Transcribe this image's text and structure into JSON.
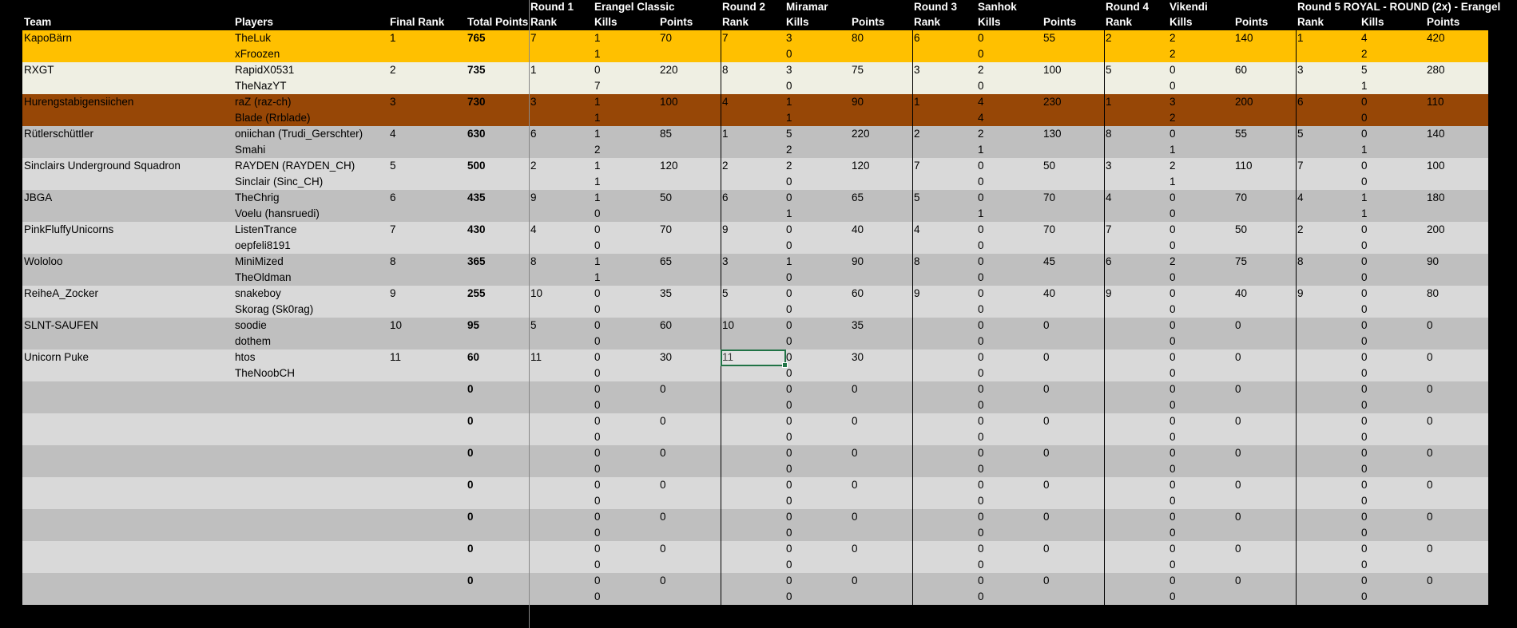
{
  "header": {
    "team": "Team",
    "players": "Players",
    "final_rank": "Final Rank",
    "total_points": "Total Points",
    "rounds": [
      {
        "round": "Round 1",
        "map": "Erangel Classic",
        "rank": "Rank",
        "kills": "Kills",
        "points": "Points"
      },
      {
        "round": "Round 2",
        "map": "Miramar",
        "rank": "Rank",
        "kills": "Kills",
        "points": "Points"
      },
      {
        "round": "Round 3",
        "map": "Sanhok",
        "rank": "Rank",
        "kills": "Kills",
        "points": "Points"
      },
      {
        "round": "Round 4",
        "map": "Vikendi",
        "rank": "Rank",
        "kills": "Kills",
        "points": "Points"
      },
      {
        "round": "Round 5 ROYAL - ROUND (2x) - Erangel",
        "map": "",
        "rank": "Rank",
        "kills": "Kills",
        "points": "Points"
      }
    ]
  },
  "colors": {
    "gold": "#ffc000",
    "cream": "#efefe3",
    "brown": "#974706",
    "grey_dark": "#bfbfbf",
    "grey_light": "#d9d9d9",
    "selection": "#217346"
  },
  "selected_cell": {
    "row": 10,
    "round": 1
  },
  "rows": [
    {
      "team": "KapoBärn",
      "p1": "TheLuk",
      "p2": "xFroozen",
      "final_rank": "1",
      "total": "765",
      "bg": "gold",
      "rounds": [
        {
          "rank": "7",
          "k1": "1",
          "k2": "1",
          "points": "70"
        },
        {
          "rank": "7",
          "k1": "3",
          "k2": "0",
          "points": "80"
        },
        {
          "rank": "6",
          "k1": "0",
          "k2": "0",
          "points": "55"
        },
        {
          "rank": "2",
          "k1": "2",
          "k2": "2",
          "points": "140"
        },
        {
          "rank": "1",
          "k1": "4",
          "k2": "2",
          "points": "420"
        }
      ]
    },
    {
      "team": "RXGT",
      "p1": "RapidX0531",
      "p2": "TheNazYT",
      "final_rank": "2",
      "total": "735",
      "bg": "cream",
      "rounds": [
        {
          "rank": "1",
          "k1": "0",
          "k2": "7",
          "points": "220"
        },
        {
          "rank": "8",
          "k1": "3",
          "k2": "0",
          "points": "75"
        },
        {
          "rank": "3",
          "k1": "2",
          "k2": "0",
          "points": "100"
        },
        {
          "rank": "5",
          "k1": "0",
          "k2": "0",
          "points": "60"
        },
        {
          "rank": "3",
          "k1": "5",
          "k2": "1",
          "points": "280"
        }
      ]
    },
    {
      "team": "Hurengstabigensiichen",
      "p1": "raZ (raz-ch)",
      "p2": "Blade (Rrblade)",
      "final_rank": "3",
      "total": "730",
      "bg": "brown",
      "rounds": [
        {
          "rank": "3",
          "k1": "1",
          "k2": "1",
          "points": "100"
        },
        {
          "rank": "4",
          "k1": "1",
          "k2": "1",
          "points": "90"
        },
        {
          "rank": "1",
          "k1": "4",
          "k2": "4",
          "points": "230"
        },
        {
          "rank": "1",
          "k1": "3",
          "k2": "2",
          "points": "200"
        },
        {
          "rank": "6",
          "k1": "0",
          "k2": "0",
          "points": "110"
        }
      ]
    },
    {
      "team": "Rütlerschüttler",
      "p1": "oniichan (Trudi_Gerschter)",
      "p2": "Smahi",
      "final_rank": "4",
      "total": "630",
      "bg": "grey_dark",
      "rounds": [
        {
          "rank": "6",
          "k1": "1",
          "k2": "2",
          "points": "85"
        },
        {
          "rank": "1",
          "k1": "5",
          "k2": "2",
          "points": "220"
        },
        {
          "rank": "2",
          "k1": "2",
          "k2": "1",
          "points": "130"
        },
        {
          "rank": "8",
          "k1": "0",
          "k2": "1",
          "points": "55"
        },
        {
          "rank": "5",
          "k1": "0",
          "k2": "1",
          "points": "140"
        }
      ]
    },
    {
      "team": "Sinclairs Underground Squadron",
      "p1": "RAYDEN (RAYDEN_CH)",
      "p2": "Sinclair (Sinc_CH)",
      "final_rank": "5",
      "total": "500",
      "bg": "grey_light",
      "rounds": [
        {
          "rank": "2",
          "k1": "1",
          "k2": "1",
          "points": "120"
        },
        {
          "rank": "2",
          "k1": "2",
          "k2": "0",
          "points": "120"
        },
        {
          "rank": "7",
          "k1": "0",
          "k2": "0",
          "points": "50"
        },
        {
          "rank": "3",
          "k1": "2",
          "k2": "1",
          "points": "110"
        },
        {
          "rank": "7",
          "k1": "0",
          "k2": "0",
          "points": "100"
        }
      ]
    },
    {
      "team": "JBGA",
      "p1": "TheChrig",
      "p2": " Voelu (hansruedi)",
      "final_rank": "6",
      "total": "435",
      "bg": "grey_dark",
      "rounds": [
        {
          "rank": "9",
          "k1": "1",
          "k2": "0",
          "points": "50"
        },
        {
          "rank": "6",
          "k1": "0",
          "k2": "1",
          "points": "65"
        },
        {
          "rank": "5",
          "k1": "0",
          "k2": "1",
          "points": "70"
        },
        {
          "rank": "4",
          "k1": "0",
          "k2": "0",
          "points": "70"
        },
        {
          "rank": "4",
          "k1": "1",
          "k2": "1",
          "points": "180"
        }
      ]
    },
    {
      "team": "PinkFluffyUnicorns",
      "p1": "ListenTrance",
      "p2": "oepfeli8191",
      "final_rank": "7",
      "total": "430",
      "bg": "grey_light",
      "rounds": [
        {
          "rank": "4",
          "k1": "0",
          "k2": "0",
          "points": "70"
        },
        {
          "rank": "9",
          "k1": "0",
          "k2": "0",
          "points": "40"
        },
        {
          "rank": "4",
          "k1": "0",
          "k2": "0",
          "points": "70"
        },
        {
          "rank": "7",
          "k1": "0",
          "k2": "0",
          "points": "50"
        },
        {
          "rank": "2",
          "k1": "0",
          "k2": "0",
          "points": "200"
        }
      ]
    },
    {
      "team": "Wololoo",
      "p1": "MiniMized",
      "p2": "TheOldman",
      "final_rank": "8",
      "total": "365",
      "bg": "grey_dark",
      "rounds": [
        {
          "rank": "8",
          "k1": "1",
          "k2": "1",
          "points": "65"
        },
        {
          "rank": "3",
          "k1": "1",
          "k2": "0",
          "points": "90"
        },
        {
          "rank": "8",
          "k1": "0",
          "k2": "0",
          "points": "45"
        },
        {
          "rank": "6",
          "k1": "2",
          "k2": "0",
          "points": "75"
        },
        {
          "rank": "8",
          "k1": "0",
          "k2": "0",
          "points": "90"
        }
      ]
    },
    {
      "team": "ReiheA_Zocker",
      "p1": "snakeboy",
      "p2": "Skorag (Sk0rag)",
      "final_rank": "9",
      "total": "255",
      "bg": "grey_light",
      "rounds": [
        {
          "rank": "10",
          "k1": "0",
          "k2": "0",
          "points": "35"
        },
        {
          "rank": "5",
          "k1": "0",
          "k2": "0",
          "points": "60"
        },
        {
          "rank": "9",
          "k1": "0",
          "k2": "0",
          "points": "40"
        },
        {
          "rank": "9",
          "k1": "0",
          "k2": "0",
          "points": "40"
        },
        {
          "rank": "9",
          "k1": "0",
          "k2": "0",
          "points": "80"
        }
      ]
    },
    {
      "team": "SLNT-SAUFEN",
      "p1": "soodie",
      "p2": "dothem",
      "final_rank": "10",
      "total": "95",
      "bg": "grey_dark",
      "rounds": [
        {
          "rank": "5",
          "k1": "0",
          "k2": "0",
          "points": "60"
        },
        {
          "rank": "10",
          "k1": "0",
          "k2": "0",
          "points": "35"
        },
        {
          "rank": "",
          "k1": "0",
          "k2": "0",
          "points": "0"
        },
        {
          "rank": "",
          "k1": "0",
          "k2": "0",
          "points": "0"
        },
        {
          "rank": "",
          "k1": "0",
          "k2": "0",
          "points": "0"
        }
      ]
    },
    {
      "team": "Unicorn Puke",
      "p1": "htos",
      "p2": "TheNoobCH",
      "final_rank": "11",
      "total": "60",
      "bg": "grey_light",
      "rounds": [
        {
          "rank": "11",
          "k1": "0",
          "k2": "0",
          "points": "30"
        },
        {
          "rank": "11",
          "k1": "0",
          "k2": "0",
          "points": "30"
        },
        {
          "rank": "",
          "k1": "0",
          "k2": "0",
          "points": "0"
        },
        {
          "rank": "",
          "k1": "0",
          "k2": "0",
          "points": "0"
        },
        {
          "rank": "",
          "k1": "0",
          "k2": "0",
          "points": "0"
        }
      ]
    },
    {
      "team": "",
      "p1": "",
      "p2": "",
      "final_rank": "",
      "total": "0",
      "bg": "grey_dark",
      "rounds": [
        {
          "rank": "",
          "k1": "0",
          "k2": "0",
          "points": "0"
        },
        {
          "rank": "",
          "k1": "0",
          "k2": "0",
          "points": "0"
        },
        {
          "rank": "",
          "k1": "0",
          "k2": "0",
          "points": "0"
        },
        {
          "rank": "",
          "k1": "0",
          "k2": "0",
          "points": "0"
        },
        {
          "rank": "",
          "k1": "0",
          "k2": "0",
          "points": "0"
        }
      ]
    },
    {
      "team": "",
      "p1": "",
      "p2": "",
      "final_rank": "",
      "total": "0",
      "bg": "grey_light",
      "rounds": [
        {
          "rank": "",
          "k1": "0",
          "k2": "0",
          "points": "0"
        },
        {
          "rank": "",
          "k1": "0",
          "k2": "0",
          "points": "0"
        },
        {
          "rank": "",
          "k1": "0",
          "k2": "0",
          "points": "0"
        },
        {
          "rank": "",
          "k1": "0",
          "k2": "0",
          "points": "0"
        },
        {
          "rank": "",
          "k1": "0",
          "k2": "0",
          "points": "0"
        }
      ]
    },
    {
      "team": "",
      "p1": "",
      "p2": "",
      "final_rank": "",
      "total": "0",
      "bg": "grey_dark",
      "rounds": [
        {
          "rank": "",
          "k1": "0",
          "k2": "0",
          "points": "0"
        },
        {
          "rank": "",
          "k1": "0",
          "k2": "0",
          "points": "0"
        },
        {
          "rank": "",
          "k1": "0",
          "k2": "0",
          "points": "0"
        },
        {
          "rank": "",
          "k1": "0",
          "k2": "0",
          "points": "0"
        },
        {
          "rank": "",
          "k1": "0",
          "k2": "0",
          "points": "0"
        }
      ]
    },
    {
      "team": "",
      "p1": "",
      "p2": "",
      "final_rank": "",
      "total": "0",
      "bg": "grey_light",
      "rounds": [
        {
          "rank": "",
          "k1": "0",
          "k2": "0",
          "points": "0"
        },
        {
          "rank": "",
          "k1": "0",
          "k2": "0",
          "points": "0"
        },
        {
          "rank": "",
          "k1": "0",
          "k2": "0",
          "points": "0"
        },
        {
          "rank": "",
          "k1": "0",
          "k2": "0",
          "points": "0"
        },
        {
          "rank": "",
          "k1": "0",
          "k2": "0",
          "points": "0"
        }
      ]
    },
    {
      "team": "",
      "p1": "",
      "p2": "",
      "final_rank": "",
      "total": "0",
      "bg": "grey_dark",
      "rounds": [
        {
          "rank": "",
          "k1": "0",
          "k2": "0",
          "points": "0"
        },
        {
          "rank": "",
          "k1": "0",
          "k2": "0",
          "points": "0"
        },
        {
          "rank": "",
          "k1": "0",
          "k2": "0",
          "points": "0"
        },
        {
          "rank": "",
          "k1": "0",
          "k2": "0",
          "points": "0"
        },
        {
          "rank": "",
          "k1": "0",
          "k2": "0",
          "points": "0"
        }
      ]
    },
    {
      "team": "",
      "p1": "",
      "p2": "",
      "final_rank": "",
      "total": "0",
      "bg": "grey_light",
      "rounds": [
        {
          "rank": "",
          "k1": "0",
          "k2": "0",
          "points": "0"
        },
        {
          "rank": "",
          "k1": "0",
          "k2": "0",
          "points": "0"
        },
        {
          "rank": "",
          "k1": "0",
          "k2": "0",
          "points": "0"
        },
        {
          "rank": "",
          "k1": "0",
          "k2": "0",
          "points": "0"
        },
        {
          "rank": "",
          "k1": "0",
          "k2": "0",
          "points": "0"
        }
      ]
    },
    {
      "team": "",
      "p1": "",
      "p2": "",
      "final_rank": "",
      "total": "0",
      "bg": "grey_dark",
      "rounds": [
        {
          "rank": "",
          "k1": "0",
          "k2": "0",
          "points": "0"
        },
        {
          "rank": "",
          "k1": "0",
          "k2": "0",
          "points": "0"
        },
        {
          "rank": "",
          "k1": "0",
          "k2": "0",
          "points": "0"
        },
        {
          "rank": "",
          "k1": "0",
          "k2": "0",
          "points": "0"
        },
        {
          "rank": "",
          "k1": "0",
          "k2": "0",
          "points": "0"
        }
      ]
    }
  ]
}
